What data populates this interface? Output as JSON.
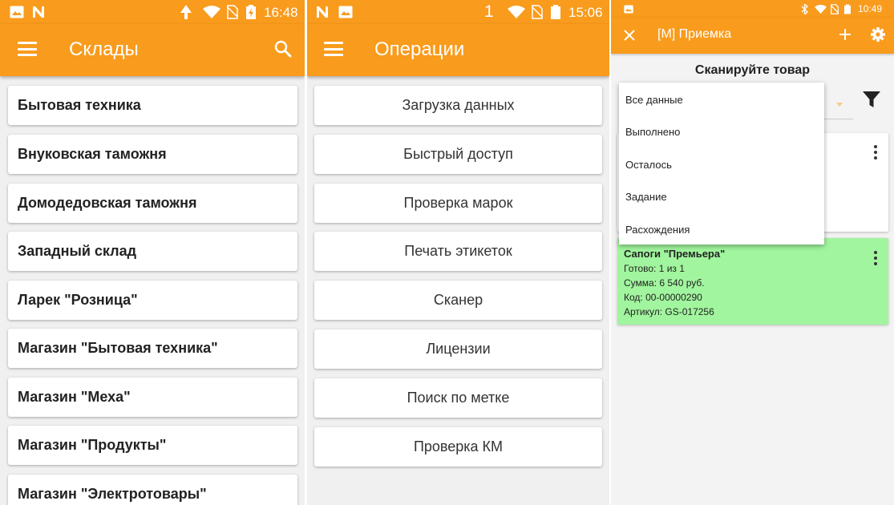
{
  "screen1": {
    "status_time": "16:48",
    "title": "Склады",
    "warehouses": [
      "Бытовая техника",
      "Внуковская таможня",
      "Домодедовская таможня",
      "Западный склад",
      "Ларек \"Розница\"",
      "Магазин \"Бытовая техника\"",
      "Магазин \"Меха\"",
      "Магазин \"Продукты\"",
      "Магазин \"Электротовары\""
    ]
  },
  "screen2": {
    "status_time": "15:06",
    "status_digit": "1",
    "title": "Операции",
    "operations": [
      "Загрузка данных",
      "Быстрый доступ",
      "Проверка марок",
      "Печать этикеток",
      "Сканер",
      "Лицензии",
      "Поиск по метке",
      "Проверка КМ"
    ]
  },
  "screen3": {
    "status_time": "10:49",
    "title": "[М] Приемка",
    "scan_title": "Сканируйте товар",
    "filter_options": [
      "Все данные",
      "Выполнено",
      "Осталось",
      "Задание",
      "Расхождения"
    ],
    "item": {
      "name": "Сапоги \"Премьера\"",
      "ready": "Готово: 1 из 1",
      "sum": "Сумма: 6 540 руб.",
      "code": "Код: 00-00000290",
      "article": "Артикул: GS-017256"
    }
  },
  "colors": {
    "accent": "#f99b1c",
    "done_item": "#a1f59e"
  }
}
